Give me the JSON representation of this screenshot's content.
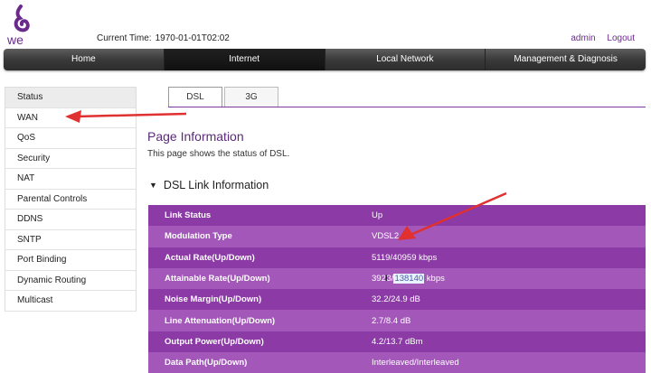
{
  "header": {
    "logo_text": "we",
    "current_time_label": "Current Time:",
    "current_time_value": "1970-01-01T02:02",
    "user_link": "admin",
    "logout_link": "Logout"
  },
  "nav": {
    "items": [
      {
        "label": "Home"
      },
      {
        "label": "Internet"
      },
      {
        "label": "Local Network"
      },
      {
        "label": "Management & Diagnosis"
      }
    ]
  },
  "sidebar": {
    "items": [
      {
        "label": "Status"
      },
      {
        "label": "WAN"
      },
      {
        "label": "QoS"
      },
      {
        "label": "Security"
      },
      {
        "label": "NAT"
      },
      {
        "label": "Parental Controls"
      },
      {
        "label": "DDNS"
      },
      {
        "label": "SNTP"
      },
      {
        "label": "Port Binding"
      },
      {
        "label": "Dynamic Routing"
      },
      {
        "label": "Multicast"
      }
    ]
  },
  "tabs": [
    {
      "label": "DSL"
    },
    {
      "label": "3G"
    }
  ],
  "page": {
    "title": "Page Information",
    "description": "This page shows the status of DSL."
  },
  "section": {
    "title": "DSL Link Information"
  },
  "rows": [
    {
      "label": "Link Status",
      "value": "Up"
    },
    {
      "label": "Modulation Type",
      "value": "VDSL2"
    },
    {
      "label": "Actual Rate(Up/Down)",
      "value": "5119/40959 kbps"
    },
    {
      "label": "Attainable Rate(Up/Down)",
      "value_prefix": "392",
      "value_cursor": "I",
      "value_mid": "3/",
      "value_highlight": "138140",
      "value_suffix": " kbps"
    },
    {
      "label": "Noise Margin(Up/Down)",
      "value": "32.2/24.9 dB"
    },
    {
      "label": "Line Attenuation(Up/Down)",
      "value": "2.7/8.4 dB"
    },
    {
      "label": "Output Power(Up/Down)",
      "value": "4.2/13.7 dBm"
    },
    {
      "label": "Data Path(Up/Down)",
      "value": "Interleaved/Interleaved"
    }
  ],
  "colors": {
    "accent": "#7a3a9a",
    "row_dark": "#8b3aa6",
    "row_light": "#a257b9",
    "annotation_arrow": "#e03030"
  }
}
